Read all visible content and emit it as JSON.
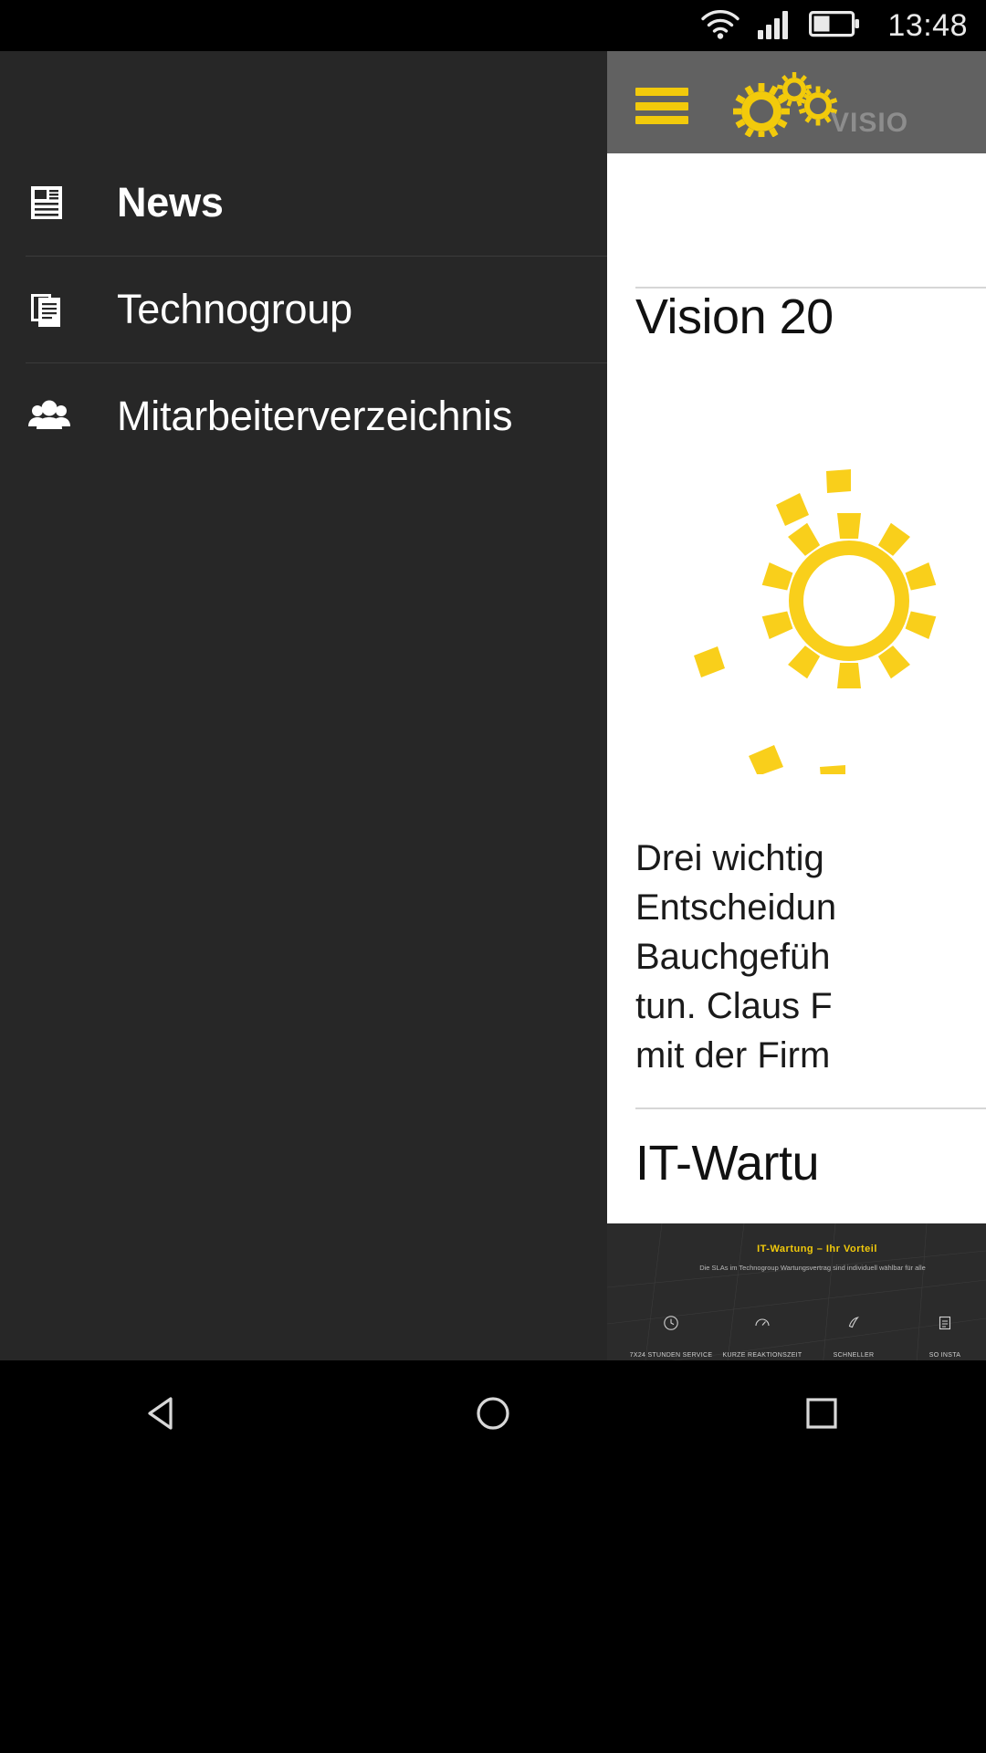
{
  "status_bar": {
    "time": "13:48",
    "icons": [
      "wifi-icon",
      "signal-icon",
      "battery-icon"
    ]
  },
  "toolbar": {
    "menu_icon": "hamburger-menu-icon",
    "logo_icon": "gears-logo-icon",
    "logo_wordmark": "VISIO",
    "accent_color": "#F2CA0B",
    "background_color": "#616161"
  },
  "drawer": {
    "background_color": "#272727",
    "items": [
      {
        "label": "News",
        "icon": "newspaper-icon",
        "active": true
      },
      {
        "label": "Technogroup",
        "icon": "documents-icon",
        "active": false
      },
      {
        "label": "Mitarbeiterverzeichnis",
        "icon": "people-group-icon",
        "active": false
      }
    ]
  },
  "content": {
    "article1": {
      "headline": "Vision 20",
      "body_lines": [
        "Drei wichtig",
        "Entscheidun",
        "Bauchgefüh",
        "tun. Claus F",
        "mit der Firm"
      ]
    },
    "article2": {
      "headline": "IT-Wartu",
      "thumbnail": {
        "title": "IT-Wartung – Ihr Vorteil",
        "subtitle": "Die SLAs im Technogroup Wartungsvertrag sind individuell wählbar für alle",
        "features": [
          {
            "icon": "clock-icon",
            "label": "7X24 STUNDEN\nSERVICE"
          },
          {
            "icon": "gauge-icon",
            "label": "KURZE\nREAKTIONSZEIT"
          },
          {
            "icon": "rocket-icon",
            "label": "SCHNELLER\nTECHNIKERANTRITT"
          },
          {
            "icon": "checklist-icon",
            "label": "SO\nINSTA"
          }
        ]
      }
    }
  },
  "system_nav": {
    "buttons": [
      {
        "name": "back-button",
        "icon": "triangle-left-icon"
      },
      {
        "name": "home-button",
        "icon": "circle-icon"
      },
      {
        "name": "recents-button",
        "icon": "square-icon"
      }
    ]
  }
}
